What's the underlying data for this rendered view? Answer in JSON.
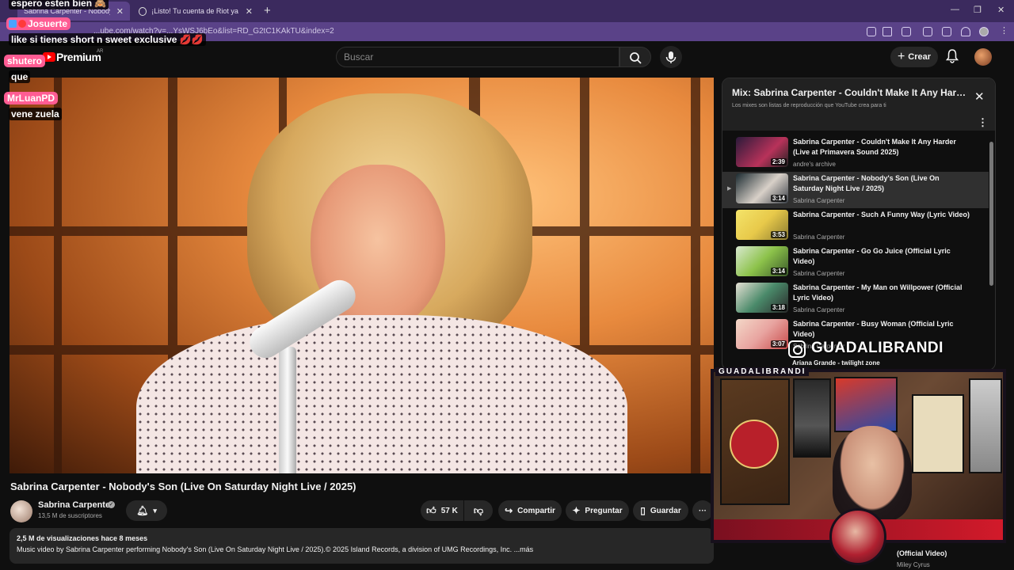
{
  "browser": {
    "tabs": [
      {
        "label": "Sabrina Carpenter - Nobody's..."
      },
      {
        "label": "¡Listo! Tu cuenta de Riot ya está co"
      }
    ],
    "new_tab": "+",
    "url": "...ube.com/watch?v=...YsWSJ6bEo&list=RD_G2tC1KAkTU&index=2",
    "window_min": "—",
    "window_restore": "❐",
    "window_close": "✕"
  },
  "header": {
    "logo_text": "Premium",
    "logo_country": "AR",
    "search_placeholder": "Buscar",
    "create_label": "Crear"
  },
  "video": {
    "title": "Sabrina Carpenter - Nobody's Son (Live On Saturday Night Live / 2025)",
    "channel": "Sabrina Carpenter",
    "subscribers": "13,5 M de suscriptores",
    "likes": "57 K",
    "share_label": "Compartir",
    "ask_label": "Preguntar",
    "save_label": "Guardar",
    "more_label": "···",
    "views_date": "2,5 M de visualizaciones  hace 8 meses",
    "description": "Music video by Sabrina Carpenter performing Nobody's Son (Live On Saturday Night Live / 2025).© 2025 Island Records, a division of UMG Recordings, Inc. ...más"
  },
  "playlist": {
    "title": "Mix: Sabrina Carpenter - Couldn't Make It Any Harder",
    "subtitle": "Los mixes son listas de reproducción que YouTube crea para ti",
    "items": [
      {
        "title": "Sabrina Carpenter - Couldn't Make It Any Harder (Live at Primavera Sound 2025)",
        "channel": "andre's archive",
        "duration": "2:39"
      },
      {
        "title": "Sabrina Carpenter - Nobody's Son (Live On Saturday Night Live / 2025)",
        "channel": "Sabrina Carpenter",
        "duration": "3:14"
      },
      {
        "title": "Sabrina Carpenter - Such A Funny Way (Lyric Video)",
        "channel": "Sabrina Carpenter",
        "duration": "3:53"
      },
      {
        "title": "Sabrina Carpenter - Go Go Juice (Official Lyric Video)",
        "channel": "Sabrina Carpenter",
        "duration": "3:14"
      },
      {
        "title": "Sabrina Carpenter - My Man on Willpower (Official Lyric Video)",
        "channel": "Sabrina Carpenter",
        "duration": "3:18"
      },
      {
        "title": "Sabrina Carpenter - Busy Woman (Official Lyric Video)",
        "channel": "Sabrina Carpenter",
        "duration": "3:07"
      }
    ],
    "next_peek": "Ariana Grande - twilight zone"
  },
  "overlay": {
    "chat": [
      {
        "text": "espero esten bien 🙈"
      },
      {
        "name": "Josuerte"
      },
      {
        "text": "like si tienes short n sweet exclusive 💋💋"
      },
      {
        "name": "shutero"
      },
      {
        "text": "que"
      },
      {
        "name": "MrLuanPD"
      },
      {
        "text": "vene zuela"
      }
    ],
    "instagram_handle": "GUADALIBRANDI",
    "cam_label": "GUADALIBRANDI",
    "under_cam_title": "(Official Video)",
    "under_cam_channel": "Miley Cyrus"
  },
  "colors": {
    "accent": "#ff0000",
    "chat_name_bg": "#ff5c93",
    "browser_frame": "#5a4288"
  }
}
